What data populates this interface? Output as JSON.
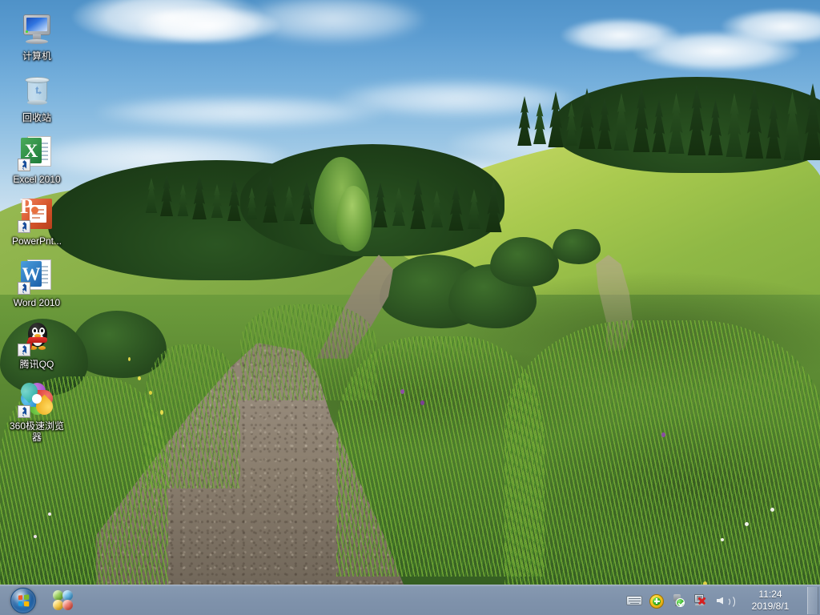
{
  "desktop": {
    "icons": [
      {
        "label": "计算机",
        "icon": "computer-icon",
        "shortcut": false
      },
      {
        "label": "回收站",
        "icon": "recycle-bin-icon",
        "shortcut": false
      },
      {
        "label": "Excel 2010",
        "icon": "excel-icon",
        "shortcut": true
      },
      {
        "label": "PowerPnt...",
        "icon": "powerpoint-icon",
        "shortcut": true
      },
      {
        "label": "Word 2010",
        "icon": "word-icon",
        "shortcut": true
      },
      {
        "label": "腾讯QQ",
        "icon": "qq-penguin-icon",
        "shortcut": true
      },
      {
        "label": "360极速浏览器",
        "icon": "360-browser-icon",
        "shortcut": true
      }
    ],
    "wallpaper": {
      "description": "绿色草地山坡小路风景",
      "sky_color": "#76b0dc",
      "grass_color": "#5e8c34",
      "path_color": "#8d8270",
      "forest_color": "#1f4119"
    }
  },
  "taskbar": {
    "background_color": "#7f92ab",
    "start_button": {
      "name": "开始",
      "icon": "windows-start-orb"
    },
    "quick_launch": [
      {
        "name": "WPS Office",
        "icon": "four-circles-icon"
      }
    ],
    "running_tasks": [],
    "tray": {
      "icons": [
        {
          "name": "输入法",
          "icon": "keyboard-icon"
        },
        {
          "name": "360安全卫士",
          "icon": "360-shield-icon"
        },
        {
          "name": "安全删除硬件",
          "icon": "usb-safely-remove-icon"
        },
        {
          "name": "网络未连接",
          "icon": "network-disconnected-icon"
        },
        {
          "name": "音量",
          "icon": "speaker-icon"
        }
      ]
    },
    "clock": {
      "time": "11:24",
      "date": "2019/8/1"
    },
    "show_desktop": {
      "name": "显示桌面"
    }
  }
}
